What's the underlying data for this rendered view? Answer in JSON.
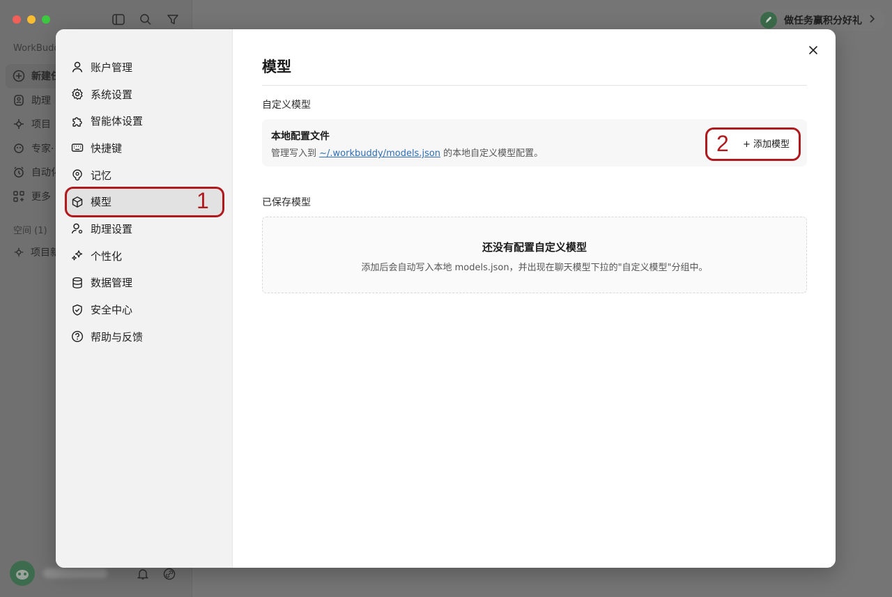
{
  "app": {
    "brand": "WorkBudd",
    "nav": [
      {
        "label": "新建任",
        "icon": "plus-circle-icon"
      },
      {
        "label": "助理",
        "icon": "assistant-icon"
      },
      {
        "label": "项目",
        "icon": "project-icon"
      },
      {
        "label": "专家·",
        "icon": "expert-icon"
      },
      {
        "label": "自动化",
        "icon": "alarm-icon"
      },
      {
        "label": "更多",
        "icon": "grid-icon"
      }
    ],
    "space_label": "空间 (1)",
    "project_label": "项目新",
    "promo": "做任务赢积分好礼"
  },
  "settings": {
    "nav": [
      {
        "label": "账户管理",
        "icon": "user-icon"
      },
      {
        "label": "系统设置",
        "icon": "gear-icon"
      },
      {
        "label": "智能体设置",
        "icon": "puzzle-icon"
      },
      {
        "label": "快捷键",
        "icon": "keyboard-icon"
      },
      {
        "label": "记忆",
        "icon": "memory-icon"
      },
      {
        "label": "模型",
        "icon": "cube-icon",
        "active": true
      },
      {
        "label": "助理设置",
        "icon": "user-gear-icon"
      },
      {
        "label": "个性化",
        "icon": "sparkle-icon"
      },
      {
        "label": "数据管理",
        "icon": "database-icon"
      },
      {
        "label": "安全中心",
        "icon": "shield-icon"
      },
      {
        "label": "帮助与反馈",
        "icon": "help-icon"
      }
    ],
    "annotation_1": "1",
    "annotation_2": "2"
  },
  "main": {
    "title": "模型",
    "custom_section": "自定义模型",
    "config_card": {
      "title": "本地配置文件",
      "desc_prefix": "管理写入到 ",
      "path": "~/.workbuddy/models.json",
      "desc_suffix": " 的本地自定义模型配置。",
      "add_button": "+ 添加模型"
    },
    "saved_section": "已保存模型",
    "empty": {
      "title": "还没有配置自定义模型",
      "subtitle": "添加后会自动写入本地 models.json，并出现在聊天模型下拉的\"自定义模型\"分组中。"
    }
  }
}
